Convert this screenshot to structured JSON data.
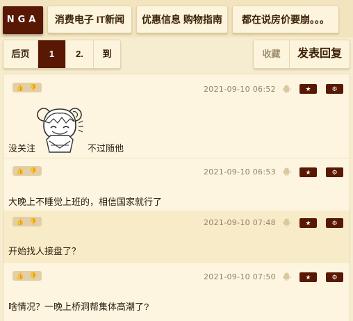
{
  "logo": "NGA",
  "nav": {
    "tabs": [
      "消费电子 IT新闻",
      "优惠信息 购物指南",
      "都在说房价要崩。。。"
    ]
  },
  "pager": {
    "prev": "后页",
    "pages": [
      "1",
      "2."
    ],
    "goto": "到"
  },
  "actions": {
    "favorite": "收藏",
    "reply": "发表回复"
  },
  "posts": [
    {
      "time": "2021-09-10 06:52",
      "content_left": "没关注",
      "content_right": "不过随他",
      "has_sticker": true
    },
    {
      "time": "2021-09-10 06:53",
      "content": "大晚上不睡觉上班的，相信国家就行了"
    },
    {
      "time": "2021-09-10 07:48",
      "content": "开始找人接盘了？"
    },
    {
      "time": "2021-09-10 07:50",
      "content": "啥情况？一晚上桥洞帮集体高潮了?"
    }
  ],
  "icons": {
    "thumb_up": "thumbs-up-icon",
    "thumb_down": "thumbs-down-icon",
    "device": "android-icon",
    "star": "star-icon",
    "settings": "gear-icon"
  },
  "colors": {
    "brand": "#591804",
    "background": "#f6ecd0",
    "post_light": "#fdf5e0",
    "post_dark": "#f8ebc8"
  }
}
